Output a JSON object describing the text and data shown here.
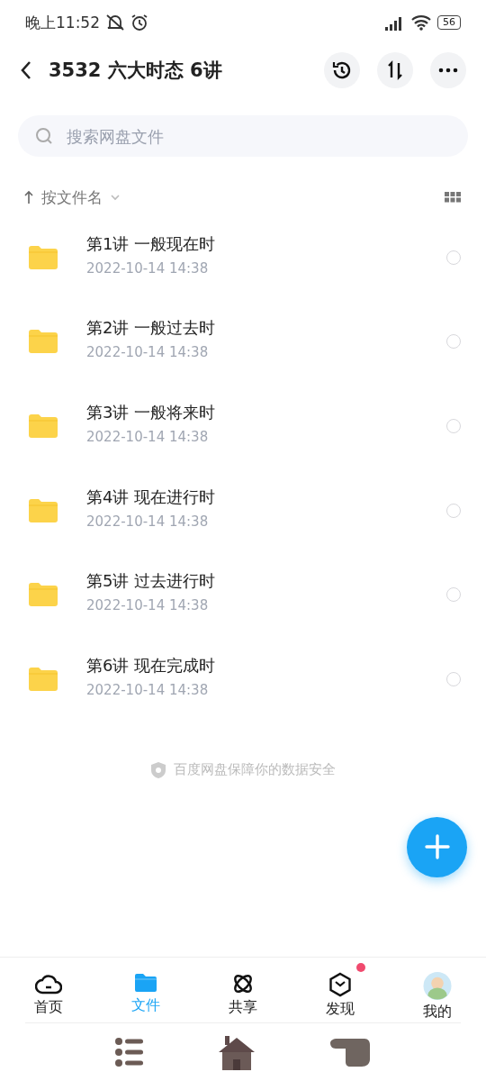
{
  "status_bar": {
    "time": "晚上11:52",
    "battery": "56"
  },
  "header": {
    "title": "3532 六大时态 6讲"
  },
  "search": {
    "placeholder": "搜索网盘文件"
  },
  "sort": {
    "label": "按文件名"
  },
  "files": [
    {
      "name": "第1讲 一般现在时",
      "date": "2022-10-14  14:38",
      "checked": false
    },
    {
      "name": "第2讲 一般过去时",
      "date": "2022-10-14  14:38",
      "checked": false
    },
    {
      "name": "第3讲 一般将来时",
      "date": "2022-10-14  14:38",
      "checked": false
    },
    {
      "name": "第4讲 现在进行时",
      "date": "2022-10-14  14:38",
      "checked": false
    },
    {
      "name": "第5讲 过去进行时",
      "date": "2022-10-14  14:38",
      "checked": false
    },
    {
      "name": "第6讲 现在完成时",
      "date": "2022-10-14  14:38",
      "checked": false
    }
  ],
  "footer_note": "百度网盘保障你的数据安全",
  "tabs": [
    {
      "label": "首页",
      "kind": "home",
      "selected": false,
      "badge": false
    },
    {
      "label": "文件",
      "kind": "files",
      "selected": true,
      "badge": false
    },
    {
      "label": "共享",
      "kind": "share",
      "selected": false,
      "badge": false
    },
    {
      "label": "发现",
      "kind": "discover",
      "selected": false,
      "badge": true
    },
    {
      "label": "我的",
      "kind": "profile",
      "selected": false,
      "badge": false
    }
  ]
}
